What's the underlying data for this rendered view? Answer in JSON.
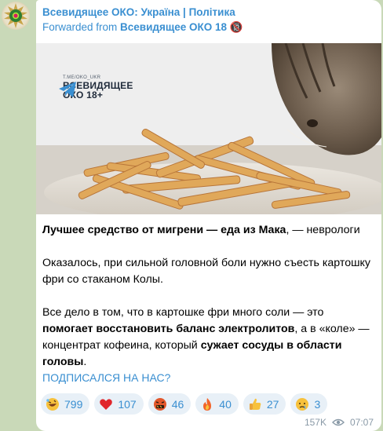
{
  "channel_name": "Всевидящее ОКО: Україна | Політика",
  "forward": {
    "prefix": "Forwarded from",
    "source": "Всевидящее ОКО 18 🔞"
  },
  "watermark": {
    "handle": "T.ME/OKO_UKR",
    "line1": "ВСЕВИДЯЩЕЕ",
    "line2": "ОКО 18+"
  },
  "post": {
    "p1_bold": "Лучшее средство от мигрени — еда из Мака",
    "p1_rest": ", — неврологи",
    "p2": "Оказалось, при сильной головной боли нужно съесть картошку фри со стаканом Колы.",
    "p3_a": "Все дело в том, что в картошке фри много соли — это ",
    "p3_b": "помогает восстановить баланс электролитов",
    "p3_c": ", а в «коле» — концентрат кофеина, который ",
    "p3_d": "сужает сосуды в области головы",
    "p3_e": ".",
    "link": "ПОДПИСАЛСЯ НА НАС?"
  },
  "reactions": [
    {
      "icon": "rofl-emoji",
      "count": "799"
    },
    {
      "icon": "heart-emoji",
      "count": "107"
    },
    {
      "icon": "cursing-face-emoji",
      "count": "46"
    },
    {
      "icon": "fire-emoji",
      "count": "40"
    },
    {
      "icon": "thumbs-up-emoji",
      "count": "27"
    },
    {
      "icon": "crying-face-emoji",
      "count": "3"
    }
  ],
  "meta": {
    "views": "157K",
    "time": "07:07"
  },
  "colors": {
    "accent": "#3a8fd1",
    "background": "#c9d9b8",
    "reaction_bg": "#e8f0f7"
  }
}
